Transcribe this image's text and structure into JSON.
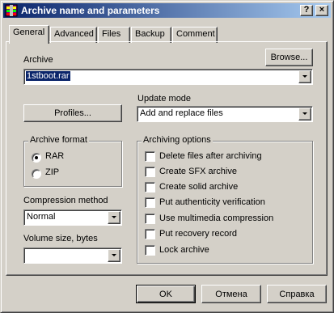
{
  "window": {
    "title": "Archive name and parameters",
    "help_button": "?",
    "close_button": "×"
  },
  "tabs": [
    {
      "label": "General",
      "active": true
    },
    {
      "label": "Advanced",
      "active": false
    },
    {
      "label": "Files",
      "active": false
    },
    {
      "label": "Backup",
      "active": false
    },
    {
      "label": "Comment",
      "active": false
    }
  ],
  "archive": {
    "label": "Archive",
    "value": "1stboot.rar",
    "browse_label": "Browse..."
  },
  "profiles_label": "Profiles...",
  "update_mode": {
    "label": "Update mode",
    "value": "Add and replace files"
  },
  "archive_format": {
    "title": "Archive format",
    "options": [
      {
        "label": "RAR",
        "checked": true
      },
      {
        "label": "ZIP",
        "checked": false
      }
    ]
  },
  "compression": {
    "label": "Compression method",
    "value": "Normal"
  },
  "volume": {
    "label": "Volume size, bytes",
    "value": ""
  },
  "archiving_options": {
    "title": "Archiving options",
    "items": [
      {
        "label": "Delete files after archiving",
        "checked": false
      },
      {
        "label": "Create SFX archive",
        "checked": false
      },
      {
        "label": "Create solid archive",
        "checked": false
      },
      {
        "label": "Put authenticity verification",
        "checked": false
      },
      {
        "label": "Use multimedia compression",
        "checked": false
      },
      {
        "label": "Put recovery record",
        "checked": false
      },
      {
        "label": "Lock archive",
        "checked": false
      }
    ]
  },
  "footer": {
    "ok": "OK",
    "cancel": "Отмена",
    "help": "Справка"
  },
  "colors": {
    "titlebar_start": "#0a246a",
    "titlebar_end": "#a6caf0",
    "face": "#d4d0c8",
    "selection": "#0a246a"
  }
}
